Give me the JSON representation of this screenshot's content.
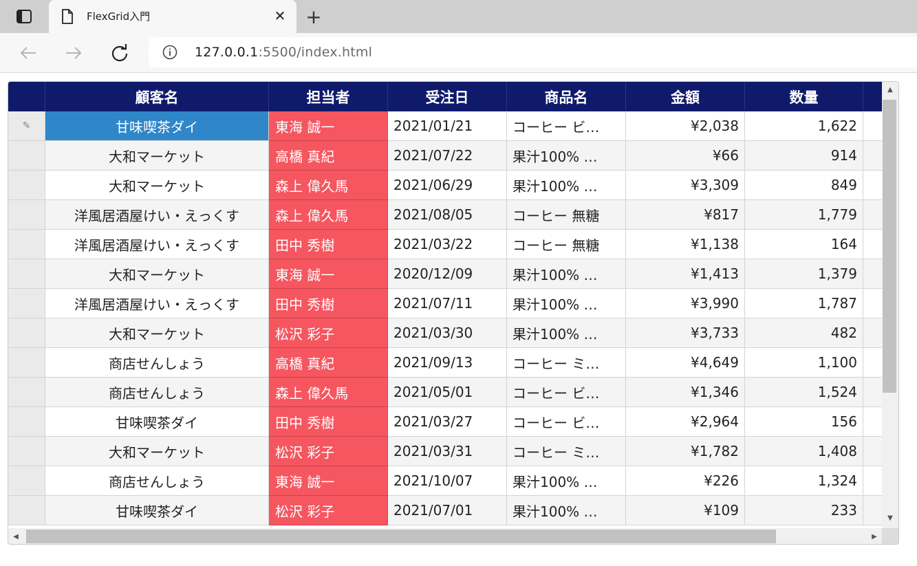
{
  "browser": {
    "tab_title": "FlexGrid入門",
    "close_glyph": "✕",
    "new_tab_glyph": "+",
    "url_host": "127.0.0.1",
    "url_rest": ":5500/index.html"
  },
  "grid": {
    "columns": [
      "顧客名",
      "担当者",
      "受注日",
      "商品名",
      "金額",
      "数量"
    ],
    "edit_glyph": "✎",
    "rows": [
      {
        "customer": "甘味喫茶ダイ",
        "rep": "東海 誠一",
        "date": "2021/01/21",
        "product": "コーヒー ビ…",
        "amount": "¥2,038",
        "qty": "1,622"
      },
      {
        "customer": "大和マーケット",
        "rep": "高橋 真紀",
        "date": "2021/07/22",
        "product": "果汁100% …",
        "amount": "¥66",
        "qty": "914"
      },
      {
        "customer": "大和マーケット",
        "rep": "森上 偉久馬",
        "date": "2021/06/29",
        "product": "果汁100% …",
        "amount": "¥3,309",
        "qty": "849"
      },
      {
        "customer": "洋風居酒屋けい・えっくす",
        "rep": "森上 偉久馬",
        "date": "2021/08/05",
        "product": "コーヒー 無糖",
        "amount": "¥817",
        "qty": "1,779"
      },
      {
        "customer": "洋風居酒屋けい・えっくす",
        "rep": "田中 秀樹",
        "date": "2021/03/22",
        "product": "コーヒー 無糖",
        "amount": "¥1,138",
        "qty": "164"
      },
      {
        "customer": "大和マーケット",
        "rep": "東海 誠一",
        "date": "2020/12/09",
        "product": "果汁100% …",
        "amount": "¥1,413",
        "qty": "1,379"
      },
      {
        "customer": "洋風居酒屋けい・えっくす",
        "rep": "田中 秀樹",
        "date": "2021/07/11",
        "product": "果汁100% …",
        "amount": "¥3,990",
        "qty": "1,787"
      },
      {
        "customer": "大和マーケット",
        "rep": "松沢 彩子",
        "date": "2021/03/30",
        "product": "果汁100% …",
        "amount": "¥3,733",
        "qty": "482"
      },
      {
        "customer": "商店せんしょう",
        "rep": "高橋 真紀",
        "date": "2021/09/13",
        "product": "コーヒー ミ…",
        "amount": "¥4,649",
        "qty": "1,100"
      },
      {
        "customer": "商店せんしょう",
        "rep": "森上 偉久馬",
        "date": "2021/05/01",
        "product": "コーヒー ビ…",
        "amount": "¥1,346",
        "qty": "1,524"
      },
      {
        "customer": "甘味喫茶ダイ",
        "rep": "田中 秀樹",
        "date": "2021/03/27",
        "product": "コーヒー ビ…",
        "amount": "¥2,964",
        "qty": "156"
      },
      {
        "customer": "大和マーケット",
        "rep": "松沢 彩子",
        "date": "2021/03/31",
        "product": "コーヒー ミ…",
        "amount": "¥1,782",
        "qty": "1,408"
      },
      {
        "customer": "商店せんしょう",
        "rep": "東海 誠一",
        "date": "2021/10/07",
        "product": "果汁100% …",
        "amount": "¥226",
        "qty": "1,324"
      },
      {
        "customer": "甘味喫茶ダイ",
        "rep": "松沢 彩子",
        "date": "2021/07/01",
        "product": "果汁100% …",
        "amount": "¥109",
        "qty": "233"
      }
    ]
  },
  "colors": {
    "header_bg": "#0f1a6b",
    "rep_bg": "#f5565f",
    "selection_bg": "#2f86c9"
  }
}
